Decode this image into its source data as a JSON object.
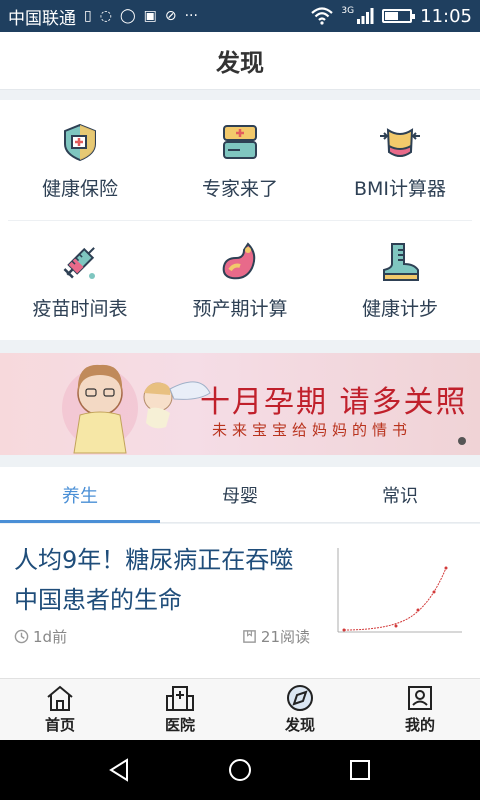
{
  "status_bar": {
    "carrier": "中国联通",
    "network": "3G",
    "time": "11:05",
    "battery_level": 0.55
  },
  "header": {
    "title": "发现"
  },
  "grid": {
    "items": [
      {
        "label": "健康保险",
        "icon": "health-insurance-icon"
      },
      {
        "label": "专家来了",
        "icon": "expert-icon"
      },
      {
        "label": "BMI计算器",
        "icon": "bmi-calculator-icon"
      },
      {
        "label": "疫苗时间表",
        "icon": "vaccine-icon"
      },
      {
        "label": "预产期计算",
        "icon": "due-date-icon"
      },
      {
        "label": "健康计步",
        "icon": "pedometer-icon"
      }
    ]
  },
  "banner": {
    "headline": "十月孕期 请多关照",
    "sub": "未来宝宝给妈妈的情书"
  },
  "tabs": [
    {
      "label": "养生",
      "active": true
    },
    {
      "label": "母婴",
      "active": false
    },
    {
      "label": "常识",
      "active": false
    }
  ],
  "article": {
    "title": "人均9年！糖尿病正在吞噬中国患者的生命",
    "age": "1d前",
    "reads": "21阅读"
  },
  "bottom_nav": [
    {
      "label": "首页",
      "icon": "home-icon"
    },
    {
      "label": "医院",
      "icon": "hospital-icon"
    },
    {
      "label": "发现",
      "icon": "discover-icon"
    },
    {
      "label": "我的",
      "icon": "profile-icon"
    }
  ],
  "colors": {
    "accent": "#4a8fd6",
    "status_bar": "#1f3f5f",
    "article_title": "#1f4d7a",
    "banner_red": "#c0202b"
  }
}
